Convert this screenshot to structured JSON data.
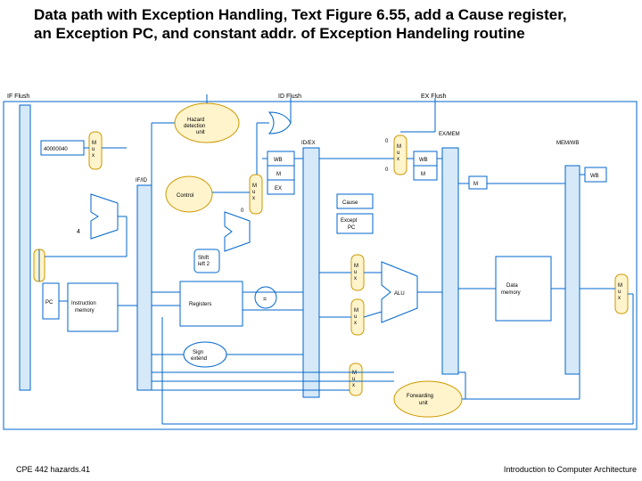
{
  "title": "Data path with Exception Handling, Text Figure 6.55, add a Cause register, an Exception PC, and constant addr. of Exception Handeling routine",
  "footer_left": "CPE 442  hazards.41",
  "footer_right": "Introduction to Computer Architecture",
  "labels": {
    "if_flush": "IF Flush",
    "id_flush": "ID Flush",
    "ex_flush": "EX Flush",
    "const_addr": "40000040",
    "hazard": "Hazard detection unit",
    "control": "Control",
    "id_ex": "ID/EX",
    "ex_mem": "EX/MEM",
    "mem_wb": "MEM/WB",
    "if_id": "IF/ID",
    "wb": "WB",
    "m": "M",
    "ex": "EX",
    "cause": "Cause",
    "except_pc": "Except PC",
    "shift": "Shift left 2",
    "registers": "Registers",
    "sign_extend": "Sign extend",
    "alu": "ALU",
    "data_mem": "Data memory",
    "instr_mem": "Instruction memory",
    "pc": "PC",
    "forwarding": "Forwarding unit",
    "mux": "M\nu\nx",
    "four": "4",
    "zero": "0",
    "eq": "="
  }
}
